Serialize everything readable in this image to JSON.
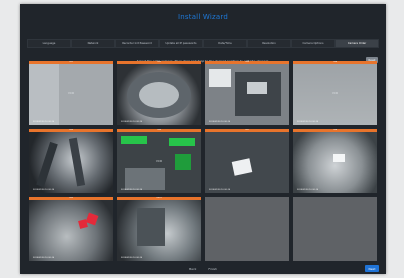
{
  "window": {
    "title": "Install Wizard"
  },
  "steps": [
    {
      "label": "Language"
    },
    {
      "label": "Network"
    },
    {
      "label": "Recorder Init Password"
    },
    {
      "label": "Update all IP passwords"
    },
    {
      "label": "Date/Time"
    },
    {
      "label": "Resolution"
    },
    {
      "label": "Camera Options"
    },
    {
      "label": "Camera Order"
    }
  ],
  "instruction": "Select the cell's camera. Then drag and drop to the desired position to edit the channel.",
  "reset_label": "Reset",
  "cameras": [
    {
      "header": "CH1",
      "label": "VCR",
      "timestamp": "2015/01/30 10:10:10",
      "state": "filled"
    },
    {
      "header": "CH2",
      "label": "",
      "timestamp": "2015/01/30 10:10:10",
      "state": "filled"
    },
    {
      "header": "CH3",
      "label": "",
      "timestamp": "2015/01/30 10:10:10",
      "state": "filled"
    },
    {
      "header": "CH4",
      "label": "VCR",
      "timestamp": "2015/01/30 10:10:10",
      "state": "filled"
    },
    {
      "header": "CH5",
      "label": "",
      "timestamp": "2015/01/30 10:10:10",
      "state": "filled"
    },
    {
      "header": "CH6",
      "label": "VCR",
      "timestamp": "2015/01/30 10:10:10",
      "state": "filled"
    },
    {
      "header": "CH7",
      "label": "",
      "timestamp": "2015/01/30 10:10:10",
      "state": "filled"
    },
    {
      "header": "CH8",
      "label": "",
      "timestamp": "2015/01/30 10:10:10",
      "state": "filled"
    },
    {
      "header": "CH9",
      "label": "",
      "timestamp": "2015/01/30 10:10:10",
      "state": "filled"
    },
    {
      "header": "CH10",
      "label": "",
      "timestamp": "2015/01/30 10:10:10",
      "state": "filled"
    },
    {
      "header": "",
      "label": "",
      "timestamp": "",
      "state": "empty"
    },
    {
      "header": "",
      "label": "",
      "timestamp": "",
      "state": "empty"
    }
  ],
  "footer": {
    "back_label": "Back",
    "finish_label": "Finish",
    "next_label": "Next"
  },
  "colors": {
    "accent": "#1f73d6",
    "header": "#e8742c",
    "window": "#20252b"
  }
}
